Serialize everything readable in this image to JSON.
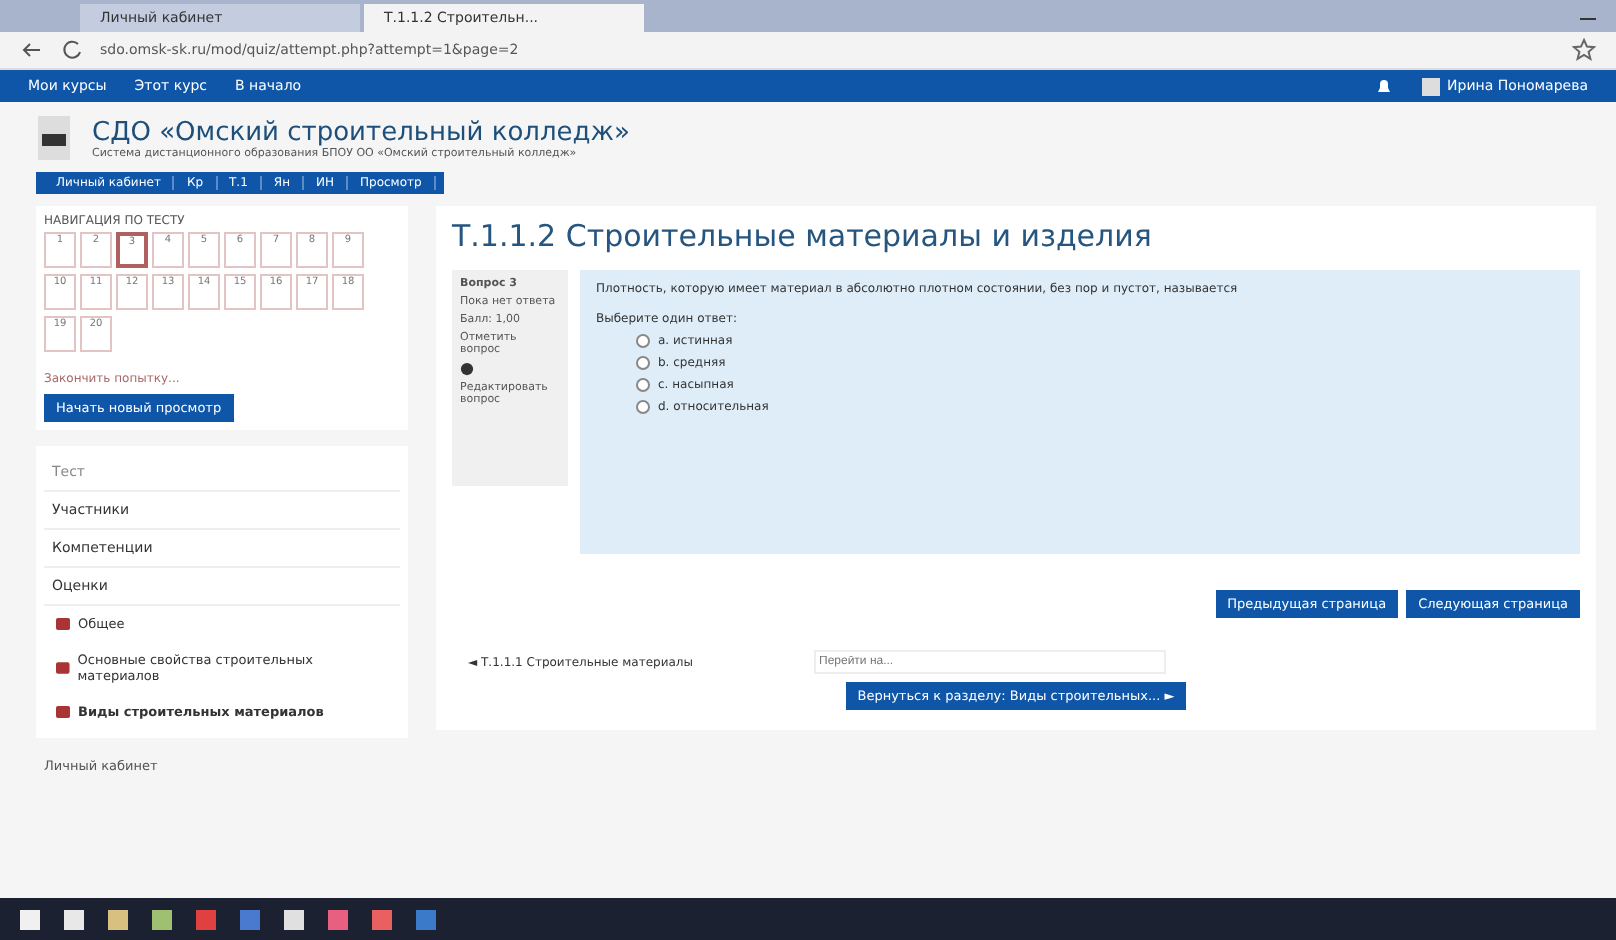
{
  "browser": {
    "tabs": [
      {
        "label": "Личный кабинет",
        "selected": false
      },
      {
        "label": "Т.1.1.2 Строительн...",
        "selected": true
      }
    ],
    "address": "sdo.omsk-sk.ru/mod/quiz/attempt.php?attempt=1&page=2"
  },
  "navbar": {
    "items": [
      "Мои курсы",
      "Этот курс",
      "В начало"
    ],
    "user": "Ирина Пономарева"
  },
  "header": {
    "title": "СДО «Омский строительный колледж»",
    "subtitle": "Система дистанционного образования БПОУ ОО «Омский строительный колледж»"
  },
  "breadcrumb": [
    "Личный кабинет",
    "Кр",
    "Т.1",
    "Ян",
    "ИН",
    "Просмотр"
  ],
  "quiz_nav": {
    "title": "НАВИГАЦИЯ ПО ТЕСТУ",
    "items": [
      {
        "label": "1",
        "selected": false
      },
      {
        "label": "2",
        "selected": false
      },
      {
        "label": "3",
        "selected": true
      },
      {
        "label": "4",
        "selected": false
      },
      {
        "label": "5",
        "selected": false
      },
      {
        "label": "6",
        "selected": false
      },
      {
        "label": "7",
        "selected": false
      },
      {
        "label": "8",
        "selected": false
      },
      {
        "label": "9",
        "selected": false
      },
      {
        "label": "10",
        "selected": false
      },
      {
        "label": "11",
        "selected": false
      },
      {
        "label": "12",
        "selected": false
      },
      {
        "label": "13",
        "selected": false
      },
      {
        "label": "14",
        "selected": false
      },
      {
        "label": "15",
        "selected": false
      },
      {
        "label": "16",
        "selected": false
      },
      {
        "label": "17",
        "selected": false
      },
      {
        "label": "18",
        "selected": false
      },
      {
        "label": "19",
        "selected": false
      },
      {
        "label": "20",
        "selected": false
      }
    ],
    "finish_link": "Закончить попытку...",
    "new_button": "Начать новый просмотр"
  },
  "sidebar": {
    "items": [
      {
        "label": "Тест",
        "kind": "heading"
      },
      {
        "label": "Участники",
        "kind": "link"
      },
      {
        "label": "Компетенции",
        "kind": "link"
      },
      {
        "label": "Оценки",
        "kind": "link"
      },
      {
        "label": "Общее",
        "kind": "section"
      },
      {
        "label": "Основные свойства строительных материалов",
        "kind": "section"
      },
      {
        "label": "Виды строительных материалов",
        "kind": "current"
      }
    ],
    "footer": "Личный кабинет"
  },
  "page_title": "Т.1.1.2 Строительные материалы и изделия",
  "question": {
    "number": "Вопрос 3",
    "status": "Пока нет ответа",
    "score": "Балл: 1,00",
    "flag": "Отметить вопрос",
    "edit": "Редактировать вопрос",
    "text": "Плотность, которую имеет материал в абсолютно плотном состоянии, без пор и пустот, называется",
    "prompt": "Выберите один ответ:",
    "options": [
      {
        "label": "a. истинная",
        "checked": false
      },
      {
        "label": "b. средняя",
        "checked": false
      },
      {
        "label": "c. насыпная",
        "checked": false
      },
      {
        "label": "d. относительная",
        "checked": false
      }
    ]
  },
  "page_buttons": [
    "Предыдущая страница",
    "Следующая страница"
  ],
  "prev_link": "◄ Т.1.1.1 Строительные материалы",
  "jump": {
    "placeholder": "Перейти на..."
  },
  "return_button": "Вернуться к разделу: Виды строительных... ►"
}
